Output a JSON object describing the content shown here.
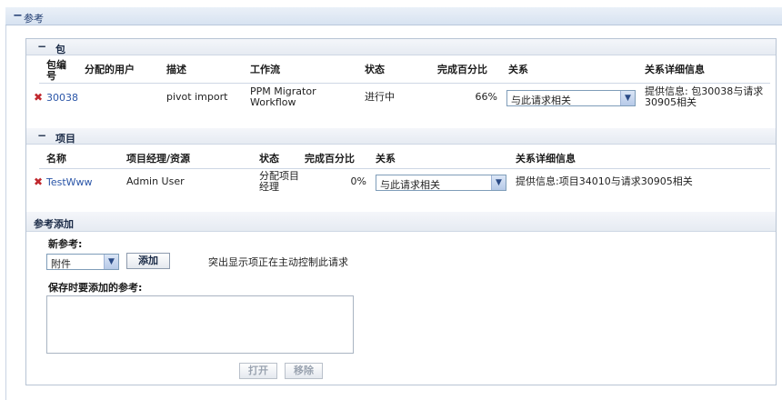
{
  "section": {
    "toggle": "−",
    "title": "参考"
  },
  "packages": {
    "toggle": "−",
    "title": "包",
    "columns": [
      "包编号",
      "分配的用户",
      "描述",
      "工作流",
      "状态",
      "完成百分比",
      "关系",
      "关系详细信息"
    ],
    "rows": [
      {
        "remove_icon": "✖",
        "id": "30038",
        "assigned_user": "",
        "description": "pivot import",
        "workflow": "PPM Migrator Workflow",
        "status": "进行中",
        "percent": "66%",
        "relationship": "与此请求相关",
        "details": "提供信息: 包30038与请求30905相关"
      }
    ]
  },
  "projects": {
    "toggle": "−",
    "title": "项目",
    "columns": [
      "名称",
      "项目经理/资源",
      "状态",
      "完成百分比",
      "关系",
      "关系详细信息"
    ],
    "rows": [
      {
        "remove_icon": "✖",
        "name": "TestWww",
        "manager": "Admin User",
        "status": "分配项目经理",
        "percent": "0%",
        "relationship": "与此请求相关",
        "details": "提供信息:项目34010与请求30905相关"
      }
    ]
  },
  "add_reference": {
    "title": "参考添加",
    "new_label": "新参考:",
    "type_select": "附件",
    "add_button": "添加",
    "hint": "突出显示项正在主动控制此请求",
    "save_label": "保存时要添加的参考:",
    "textarea_value": "",
    "open_button": "打开",
    "remove_button": "移除"
  },
  "icons": {
    "dropdown": "chevron-down-icon",
    "remove": "red-x-icon"
  },
  "colors": {
    "link": "#2b56a8",
    "remove": "#c0272d",
    "header_bg": "#e6ebf2"
  }
}
